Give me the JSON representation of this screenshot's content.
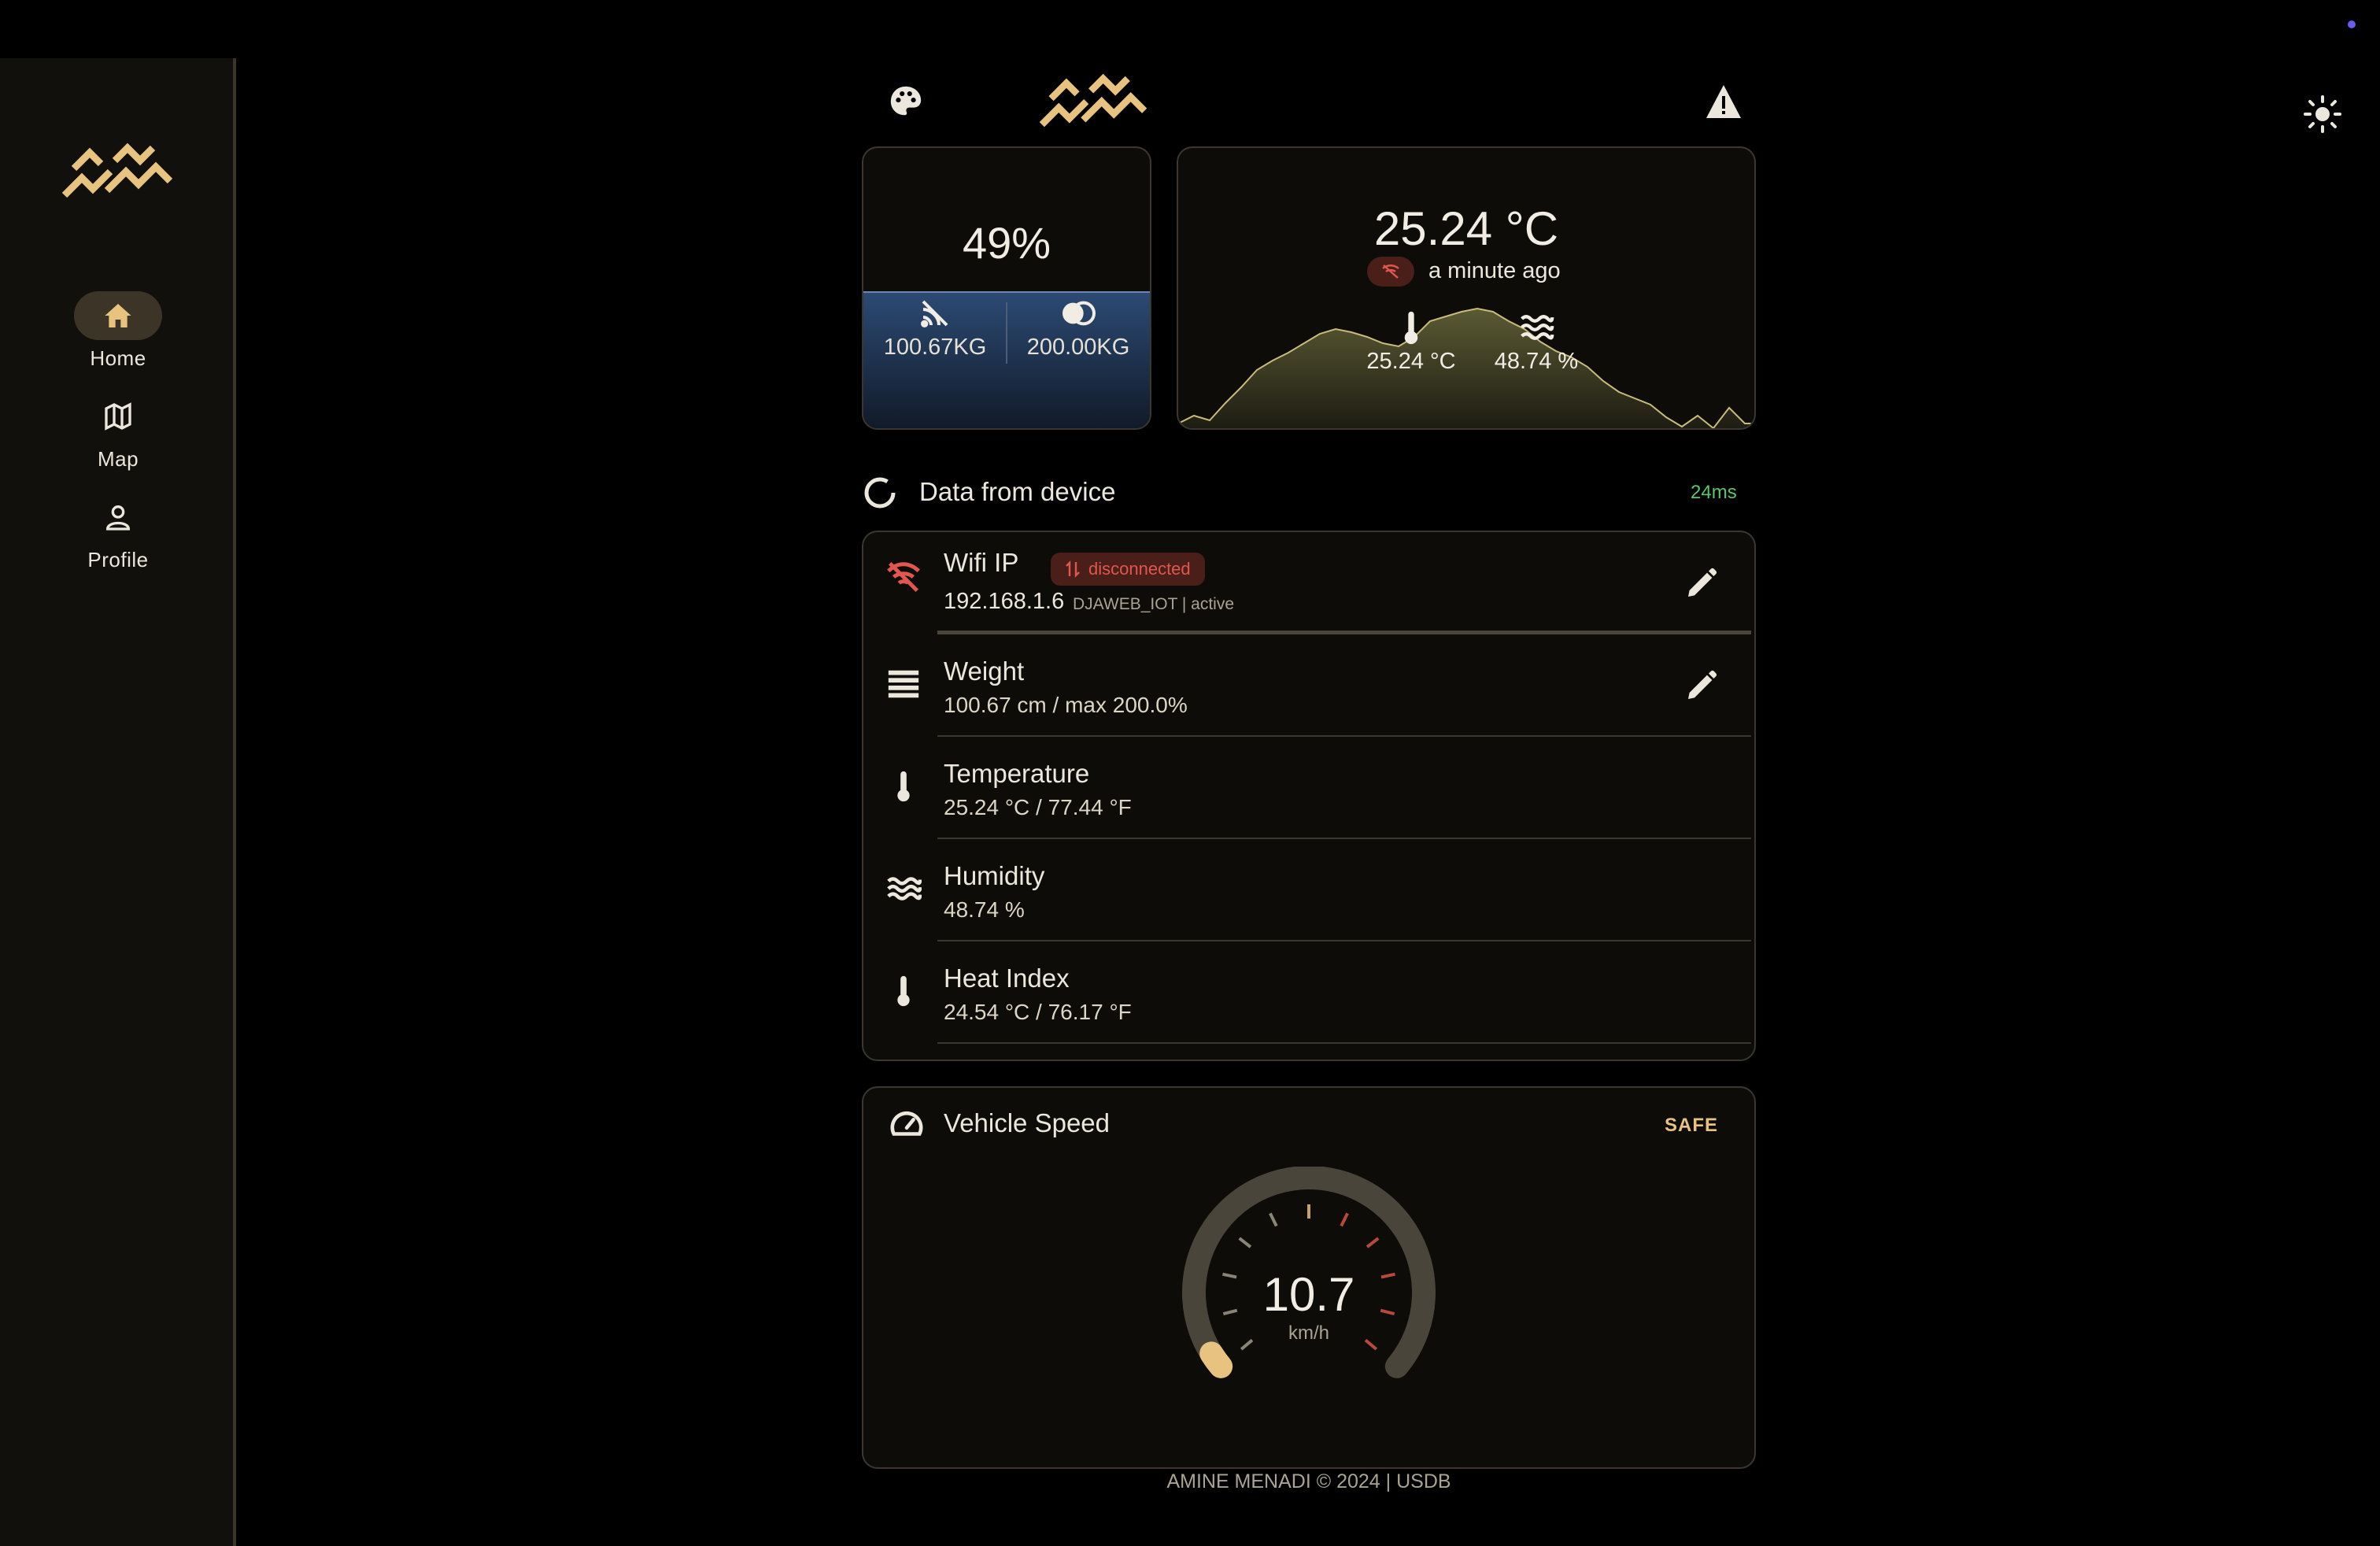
{
  "sidebar": {
    "items": [
      {
        "label": "Home",
        "icon": "home-icon"
      },
      {
        "label": "Map",
        "icon": "map-icon"
      },
      {
        "label": "Profile",
        "icon": "person-icon"
      }
    ]
  },
  "colors": {
    "accent": "#e8c27f",
    "danger": "#e0574d",
    "success": "#58c66a",
    "fill_blue": "#233a5c"
  },
  "battery": {
    "level_text": "49%",
    "level": 0.49,
    "left_value": "100.67KG",
    "right_value": "200.00KG"
  },
  "climate": {
    "temperature": "25.24 °C",
    "updated": "a minute ago",
    "temp_small": "25.24 °C",
    "humidity_small": "48.74 %"
  },
  "device": {
    "section_title": "Data from device",
    "latency": "24ms",
    "rows": [
      {
        "title": "Wifi IP",
        "badge": "disconnected",
        "value": "192.168.1.6",
        "meta": "DJAWEB_IOT | active",
        "icon": "wifi-off-icon"
      },
      {
        "title": "Weight",
        "value": "100.67 cm / max 200.0%",
        "icon": "weight-icon"
      },
      {
        "title": "Temperature",
        "value": "25.24 °C / 77.44 °F",
        "icon": "thermometer-icon"
      },
      {
        "title": "Humidity",
        "value": "48.74 %",
        "icon": "waves-icon"
      },
      {
        "title": "Heat Index",
        "value": "24.54 °C / 76.17 °F",
        "icon": "thermometer-icon"
      }
    ]
  },
  "speed": {
    "title": "Vehicle Speed",
    "status": "SAFE",
    "value": "10.7",
    "unit": "km/h"
  },
  "footer": "AMINE MENADI © 2024 | USDB"
}
